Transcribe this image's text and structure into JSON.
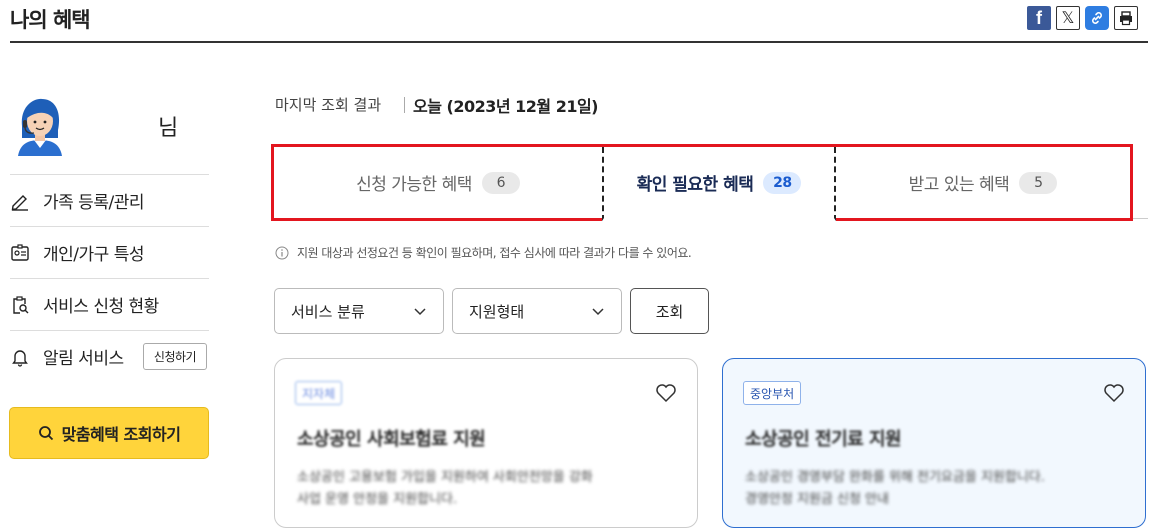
{
  "page": {
    "title": "나의 혜택"
  },
  "share": {
    "facebook": "f",
    "x": "𝕏"
  },
  "sidebar": {
    "user_suffix": "님",
    "items": [
      {
        "label": "가족 등록/관리",
        "icon": "pencil-icon"
      },
      {
        "label": "개인/가구 특성",
        "icon": "id-card-icon"
      },
      {
        "label": "서비스 신청 현황",
        "icon": "clipboard-search-icon"
      },
      {
        "label": "알림 서비스",
        "icon": "bell-icon",
        "button": "신청하기"
      }
    ],
    "custom_search": "맞춤혜택 조회하기"
  },
  "result": {
    "last_label": "마지막 조회 결과",
    "last_value": "오늘 (2023년 12월 21일)"
  },
  "tabs": [
    {
      "label": "신청 가능한 혜택",
      "count": "6"
    },
    {
      "label": "확인 필요한 혜택",
      "count": "28",
      "active": true
    },
    {
      "label": "받고 있는 혜택",
      "count": "5"
    }
  ],
  "notice": "지원 대상과 선정요건 등 확인이 필요하며, 접수 심사에 따라 결과가 다를 수 있어요.",
  "filters": {
    "category": "서비스 분류",
    "support_type": "지원형태",
    "search": "조회"
  },
  "cards": [
    {
      "tag": "지자체",
      "title": "소상공인 사회보험료 지원",
      "desc1": "소상공인 고용보험 가입을 지원하여 사회안전망을 강화",
      "desc2": "사업 운영 안정을 지원합니다."
    },
    {
      "tag": "중앙부처",
      "title": "소상공인 전기료 지원",
      "desc1": "소상공인 경영부담 완화를 위해 전기요금을 지원합니다.",
      "desc2": "경영안정 지원금 신청 안내"
    }
  ]
}
